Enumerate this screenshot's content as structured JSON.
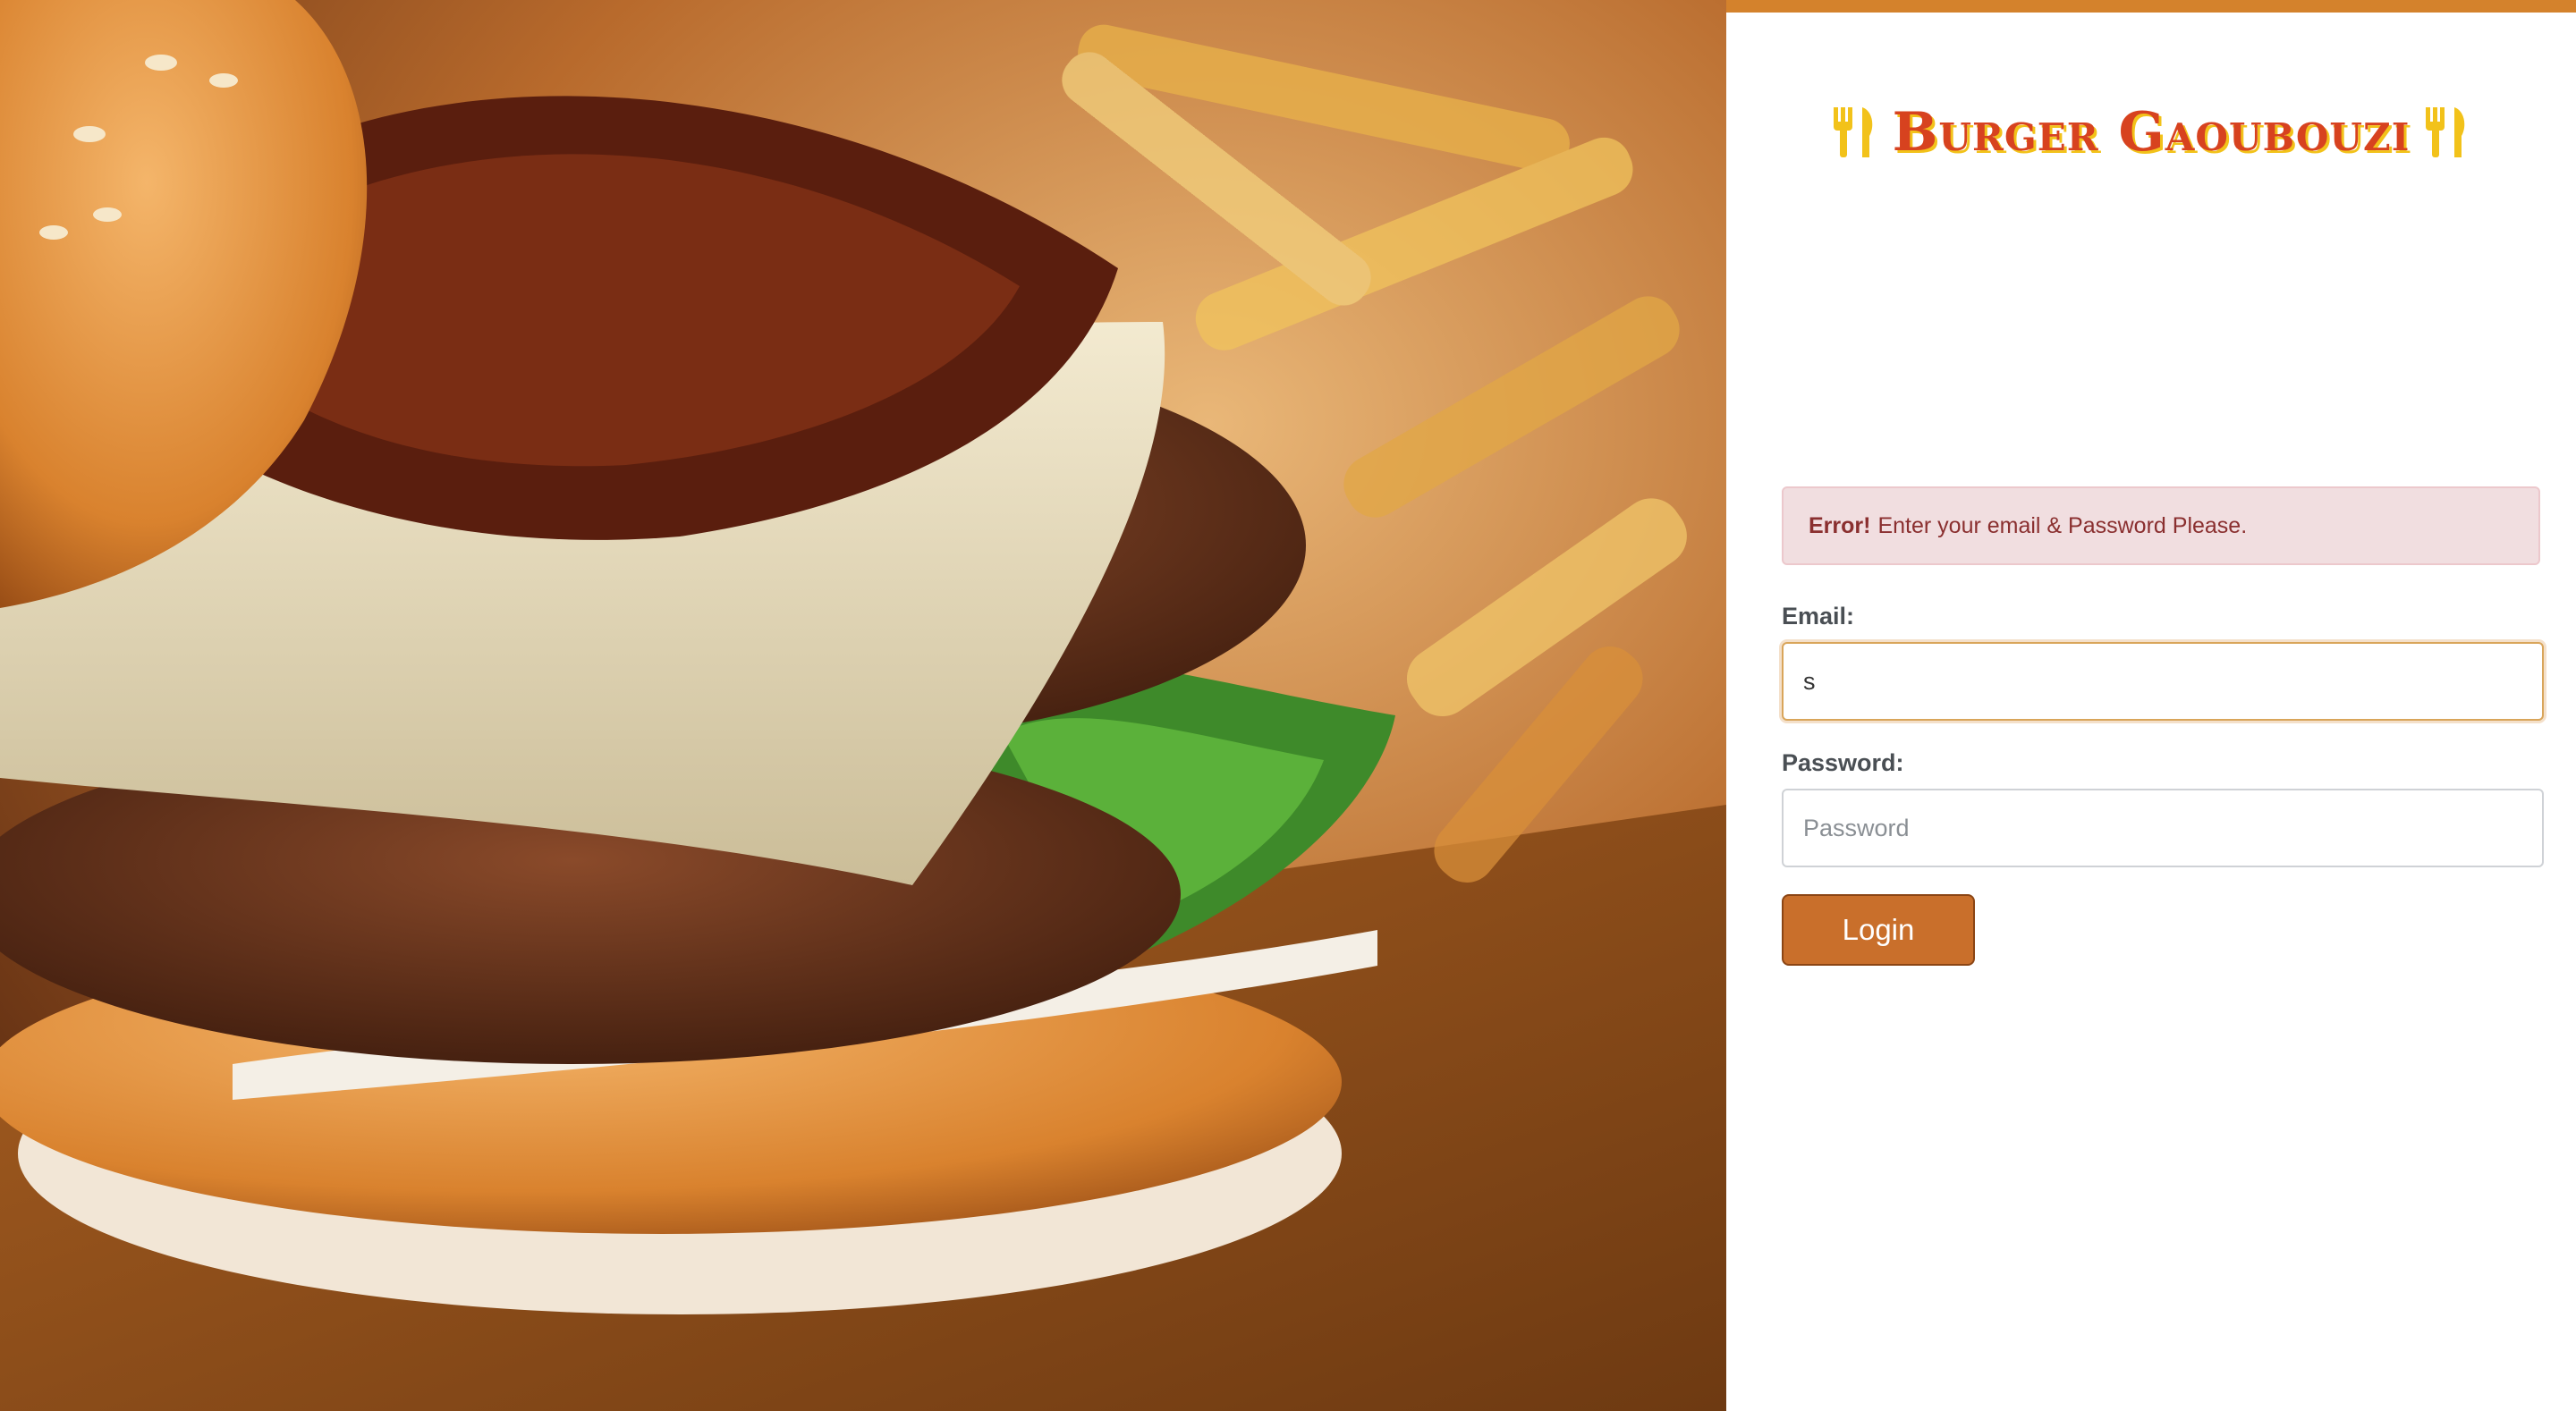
{
  "brand": {
    "title": "Burger Gaoubouzi",
    "icon": "utensils-icon",
    "accent_color": "#d4822c",
    "title_color": "#d7421f",
    "title_shadow_color": "#f2c21a"
  },
  "hero": {
    "image": "burger-with-fries-photo"
  },
  "alert": {
    "strong": "Error!",
    "message": "Enter your email & Password Please."
  },
  "form": {
    "email_label": "Email:",
    "email_value": "s",
    "password_label": "Password:",
    "password_placeholder": "Password",
    "password_value": "",
    "login_label": "Login",
    "button_color": "#c96f2b"
  }
}
